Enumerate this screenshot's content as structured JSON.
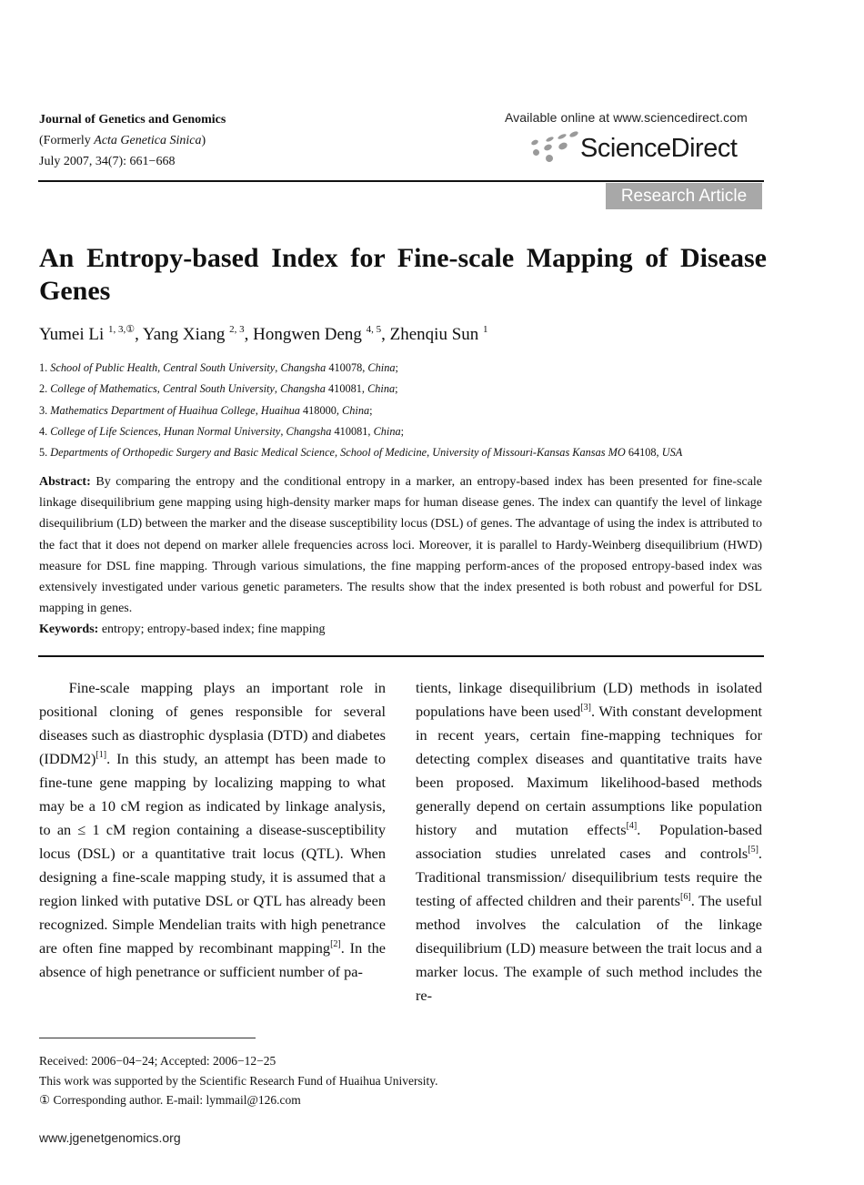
{
  "header": {
    "journal_name": "Journal of Genetics and Genomics",
    "formerly_prefix": "(Formerly ",
    "formerly_name": "Acta Genetica Sinica",
    "formerly_suffix": ")",
    "issue": "July 2007, 34(7): 661−668",
    "available_online": "Available online at www.sciencedirect.com",
    "publisher_logo_text": "ScienceDirect",
    "publisher_logo_icon": "sciencedirect-dots-icon",
    "article_type": "Research Article",
    "badge_color": "#a8a8a8"
  },
  "title": "An Entropy-based Index for Fine-scale Mapping of Disease Genes",
  "authors": [
    {
      "name": "Yumei Li",
      "sup": "1, 3,①"
    },
    {
      "name": "Yang Xiang",
      "sup": "2, 3"
    },
    {
      "name": "Hongwen Deng",
      "sup": "4, 5"
    },
    {
      "name": "Zhenqiu Sun",
      "sup": "1"
    }
  ],
  "affiliations": [
    {
      "num": "1.",
      "parts": [
        "School of Public Health",
        "Central South University",
        "Changsha"
      ],
      "code": "410078",
      "country": "China",
      "end": ";"
    },
    {
      "num": "2.",
      "parts": [
        "College of Mathematics",
        "Central South University",
        "Changsha"
      ],
      "code": "410081",
      "country": "China",
      "end": ";"
    },
    {
      "num": "3.",
      "parts": [
        "Mathematics Department of Huaihua College",
        "Huaihua"
      ],
      "code": "418000",
      "country": "China",
      "end": ";"
    },
    {
      "num": "4.",
      "parts": [
        "College of Life Sciences",
        "Hunan Normal University",
        "Changsha"
      ],
      "code": "410081",
      "country": "China",
      "end": ";"
    },
    {
      "num": "5.",
      "parts": [
        "Departments of Orthopedic Surgery and Basic Medical Science",
        "School of Medicine",
        "University of Missouri-Kansas Kansas MO"
      ],
      "code": "64108",
      "country": "USA",
      "end": ""
    }
  ],
  "abstract": {
    "label": "Abstract:",
    "text": "By comparing the entropy and the conditional entropy in a marker, an entropy-based index has been presented for fine-scale linkage disequilibrium gene mapping using high-density marker maps for human disease genes. The index can quantify the level of linkage disequilibrium (LD) between the marker and the disease susceptibility locus (DSL) of genes. The advantage of using the index is attributed to the fact that it does not depend on marker allele frequencies across loci. Moreover, it is parallel to Hardy-Weinberg disequilibrium (HWD) measure for DSL fine mapping. Through various simulations, the fine mapping perform-ances of the proposed entropy-based index was extensively investigated under various genetic parameters. The results show that the index presented is both robust and powerful for DSL mapping in genes."
  },
  "keywords": {
    "label": "Keywords:",
    "text": "entropy; entropy-based index; fine mapping"
  },
  "body": {
    "left_segments": [
      {
        "t": "Fine-scale mapping plays an important role in positional cloning of genes responsible for several diseases such as diastrophic dysplasia (DTD) and diabetes (IDDM2)"
      },
      {
        "sup": "[1]"
      },
      {
        "t": ". In this study, an attempt has been made to fine-tune gene mapping by localizing mapping to what may be a 10 cM region as indicated by linkage analysis, to an ≤ 1 cM region containing a disease-susceptibility locus (DSL) or a quantitative trait locus (QTL). When designing a fine-scale mapping study, it is assumed that a region linked with putative DSL or QTL has already been recognized. Simple Mendelian traits with high penetrance are often fine mapped by recombinant mapping"
      },
      {
        "sup": "[2]"
      },
      {
        "t": ". In the absence of high penetrance or sufficient number of pa-"
      }
    ],
    "right_segments": [
      {
        "t": "tients, linkage disequilibrium (LD) methods in isolated populations have been used"
      },
      {
        "sup": "[3]"
      },
      {
        "t": ". With constant development in recent years, certain fine-mapping techniques for detecting complex diseases and quantitative traits have been proposed. Maximum likelihood-based methods generally depend on certain assumptions like population history and mutation effects"
      },
      {
        "sup": "[4]"
      },
      {
        "t": ". Population-based association studies unrelated cases and controls"
      },
      {
        "sup": "[5]"
      },
      {
        "t": ". Traditional transmission/ disequilibrium tests require the testing of affected children and their parents"
      },
      {
        "sup": "[6]"
      },
      {
        "t": ". The useful method involves the calculation of the linkage disequilibrium (LD) measure between the trait locus and a marker locus. The example of such method includes the re-"
      }
    ]
  },
  "footnotes": {
    "received": "Received: 2006−04−24; Accepted: 2006−12−25",
    "funding": "This work was supported by the Scientific Research Fund of Huaihua University.",
    "corresponding": "①  Corresponding author. E-mail: lymmail@126.com"
  },
  "footer": {
    "website": "www.jgenetgenomics.org"
  }
}
